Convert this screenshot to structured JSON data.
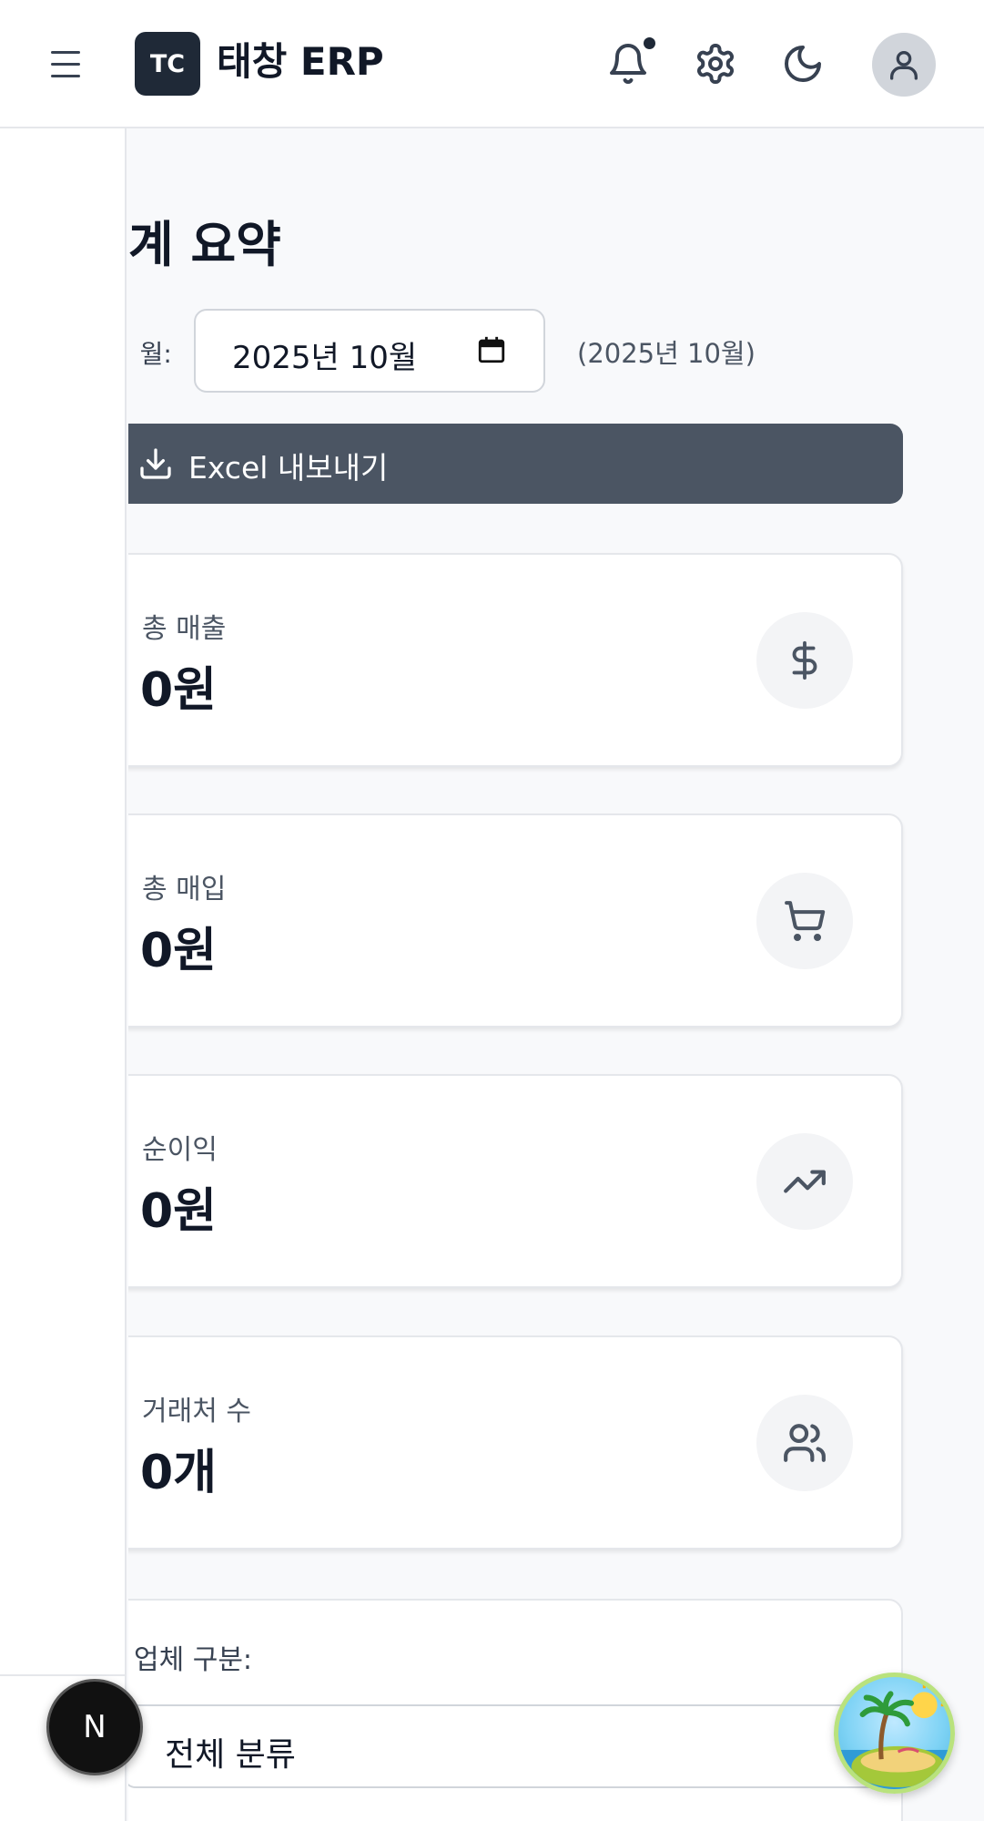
{
  "header": {
    "logo_text": "TC",
    "app_title": "태창 ERP"
  },
  "page": {
    "title": "계 요약",
    "month_label": "ㅣ 월:",
    "month_value": "2025년 10월",
    "month_note": "(2025년 10월)",
    "export_label": "Excel 내보내기"
  },
  "cards": [
    {
      "label": "총 매출",
      "value": "0원",
      "icon": "dollar-icon"
    },
    {
      "label": "총 매입",
      "value": "0원",
      "icon": "cart-icon"
    },
    {
      "label": "순이익",
      "value": "0원",
      "icon": "trending-up-icon"
    },
    {
      "label": "거래처 수",
      "value": "0개",
      "icon": "users-icon"
    }
  ],
  "filter": {
    "label": "업체 구분:",
    "selected": "전체 분류"
  },
  "floating": {
    "next_badge": "N"
  }
}
